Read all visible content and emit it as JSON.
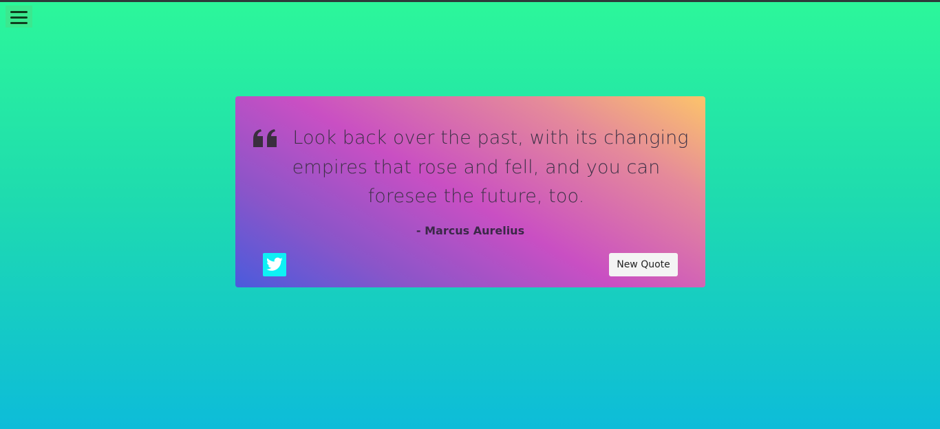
{
  "menu": {
    "icon": "hamburger-menu-icon"
  },
  "quote": {
    "icon": "quote-left-icon",
    "text": "Look back over the past, with its changing empires that rose and fell, and you can foresee the future, too.",
    "author": "- Marcus Aurelius"
  },
  "actions": {
    "tweet_icon": "twitter-icon",
    "new_quote_label": "New Quote"
  },
  "colors": {
    "page_gradient_top": "#2cf79a",
    "page_gradient_bottom": "#0dbcd9",
    "card_gradient": [
      "#4a5bdc",
      "#c94fc3",
      "#fcc46a"
    ],
    "quote_text": "#3d3147",
    "tweet_button": "#0ef1f5",
    "menu_button": "#3be88f"
  }
}
